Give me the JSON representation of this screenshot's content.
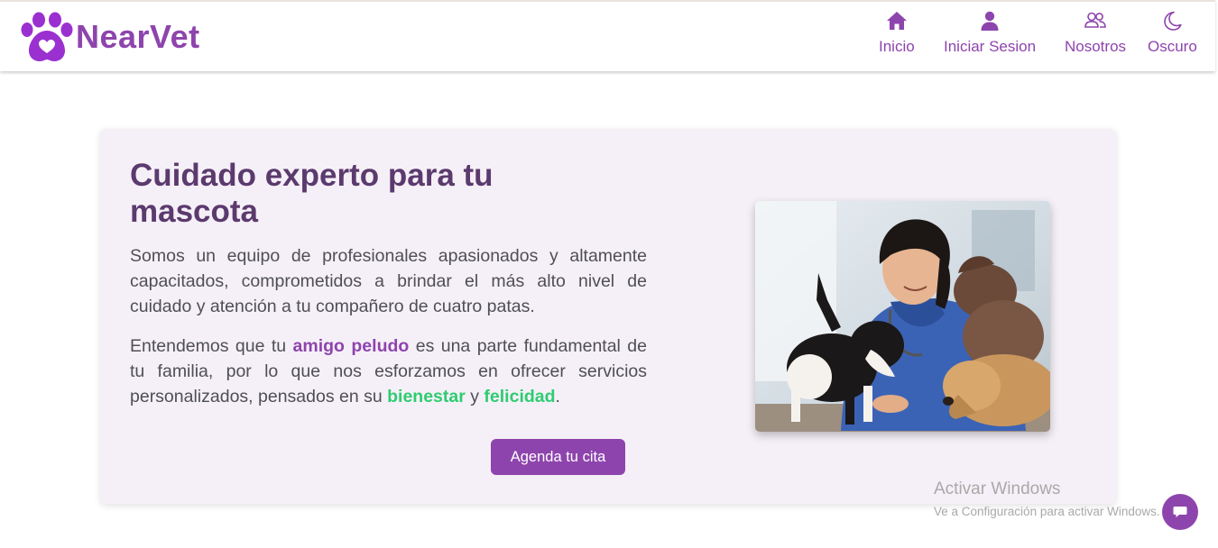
{
  "brand": {
    "name": "NearVet",
    "logo_icon": "paw-heart-icon"
  },
  "nav": {
    "items": [
      {
        "label": "Inicio",
        "icon": "home-icon"
      },
      {
        "label": "Iniciar Sesion",
        "icon": "user-icon"
      },
      {
        "label": "Nosotros",
        "icon": "users-icon"
      },
      {
        "label": "Oscuro",
        "icon": "moon-icon"
      }
    ]
  },
  "hero": {
    "title": "Cuidado experto para tu mascota",
    "paragraph1": "Somos un equipo de profesionales apasionados y altamente capacitados, comprometidos a brindar el más alto nivel de cuidado y atención a tu compañero de cuatro patas.",
    "paragraph2": {
      "part1": "Entendemos que tu ",
      "highlight1": "amigo peludo",
      "part2": " es una parte fundamental de tu familia, por lo que nos esforzamos en ofrecer servicios personalizados, pensados en su ",
      "highlight2": "bienestar",
      "part3": " y ",
      "highlight3": "felicidad",
      "part4": "."
    },
    "cta_label": "Agenda tu cita",
    "image_alt": "veterinaria con cachorros"
  },
  "watermark": {
    "title": "Activar Windows",
    "subtitle": "Ve a Configuración para activar Windows."
  },
  "chat": {
    "icon": "chat-icon"
  },
  "colors": {
    "primary": "#8e44ad",
    "title": "#5b3a6e",
    "green": "#2ecc71",
    "hero_bg": "#f5f0f7"
  }
}
